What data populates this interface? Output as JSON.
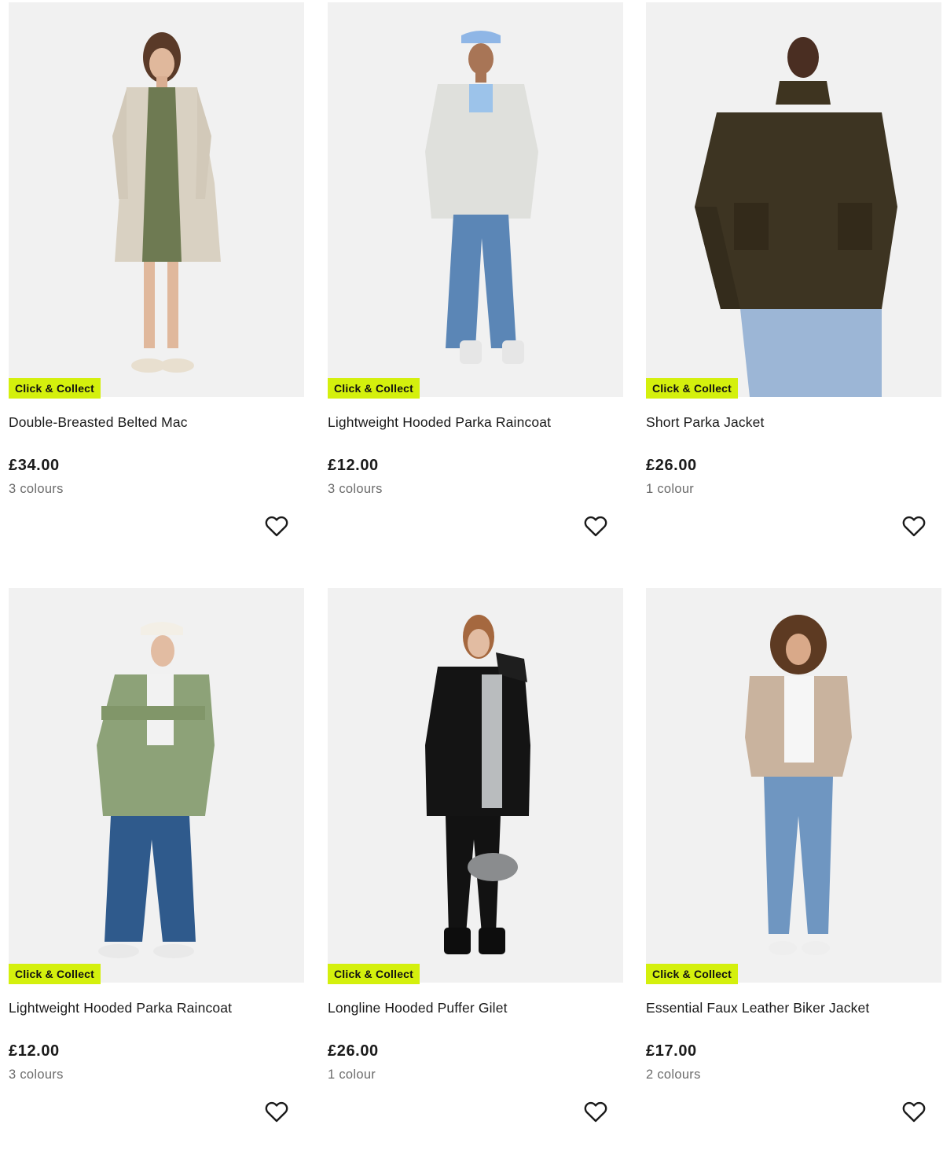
{
  "products": [
    {
      "name": "Double-Breasted Belted Mac",
      "price": "£34.00",
      "colours": "3 colours",
      "badge": "Click & Collect",
      "image": "woman-beige-trench-coat"
    },
    {
      "name": "Lightweight Hooded Parka Raincoat",
      "price": "£12.00",
      "colours": "3 colours",
      "badge": "Click & Collect",
      "image": "woman-light-grey-parka"
    },
    {
      "name": "Short Parka Jacket",
      "price": "£26.00",
      "colours": "1 colour",
      "badge": "Click & Collect",
      "image": "woman-khaki-short-parka"
    },
    {
      "name": "Lightweight Hooded Parka Raincoat",
      "price": "£12.00",
      "colours": "3 colours",
      "badge": "Click & Collect",
      "image": "woman-sage-green-parka"
    },
    {
      "name": "Longline Hooded Puffer Gilet",
      "price": "£26.00",
      "colours": "1 colour",
      "badge": "Click & Collect",
      "image": "woman-black-puffer-gilet"
    },
    {
      "name": "Essential Faux Leather Biker Jacket",
      "price": "£17.00",
      "colours": "2 colours",
      "badge": "Click & Collect",
      "image": "woman-beige-biker-jacket"
    }
  ],
  "wishlist_icon": "heart-outline-icon",
  "colors": {
    "badge_bg": "#d4f00d",
    "image_bg": "#f1f1f1",
    "text": "#1a1a1a",
    "muted": "#6b6b6b"
  }
}
